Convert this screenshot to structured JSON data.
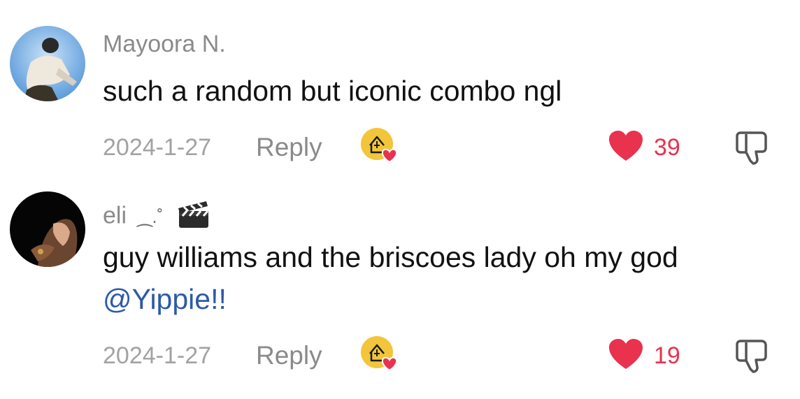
{
  "comments": [
    {
      "username": "Mayoora N.",
      "text": "such a random but iconic combo ngl",
      "date": "2024-1-27",
      "reply_label": "Reply",
      "likes": "39"
    },
    {
      "username": "eli",
      "username_decor": "⁔.˚",
      "text": "guy williams and the briscoes lady oh my god",
      "mention": "@Yippie!!",
      "date": "2024-1-27",
      "reply_label": "Reply",
      "likes": "19"
    }
  ],
  "colors": {
    "like_red": "#e8324e",
    "mention_blue": "#2d5aa8",
    "badge_yellow": "#f2c53a"
  },
  "icons": [
    "heart-icon",
    "thumbs-down-icon",
    "creator-liked-badge-icon",
    "clapper-board-icon"
  ]
}
